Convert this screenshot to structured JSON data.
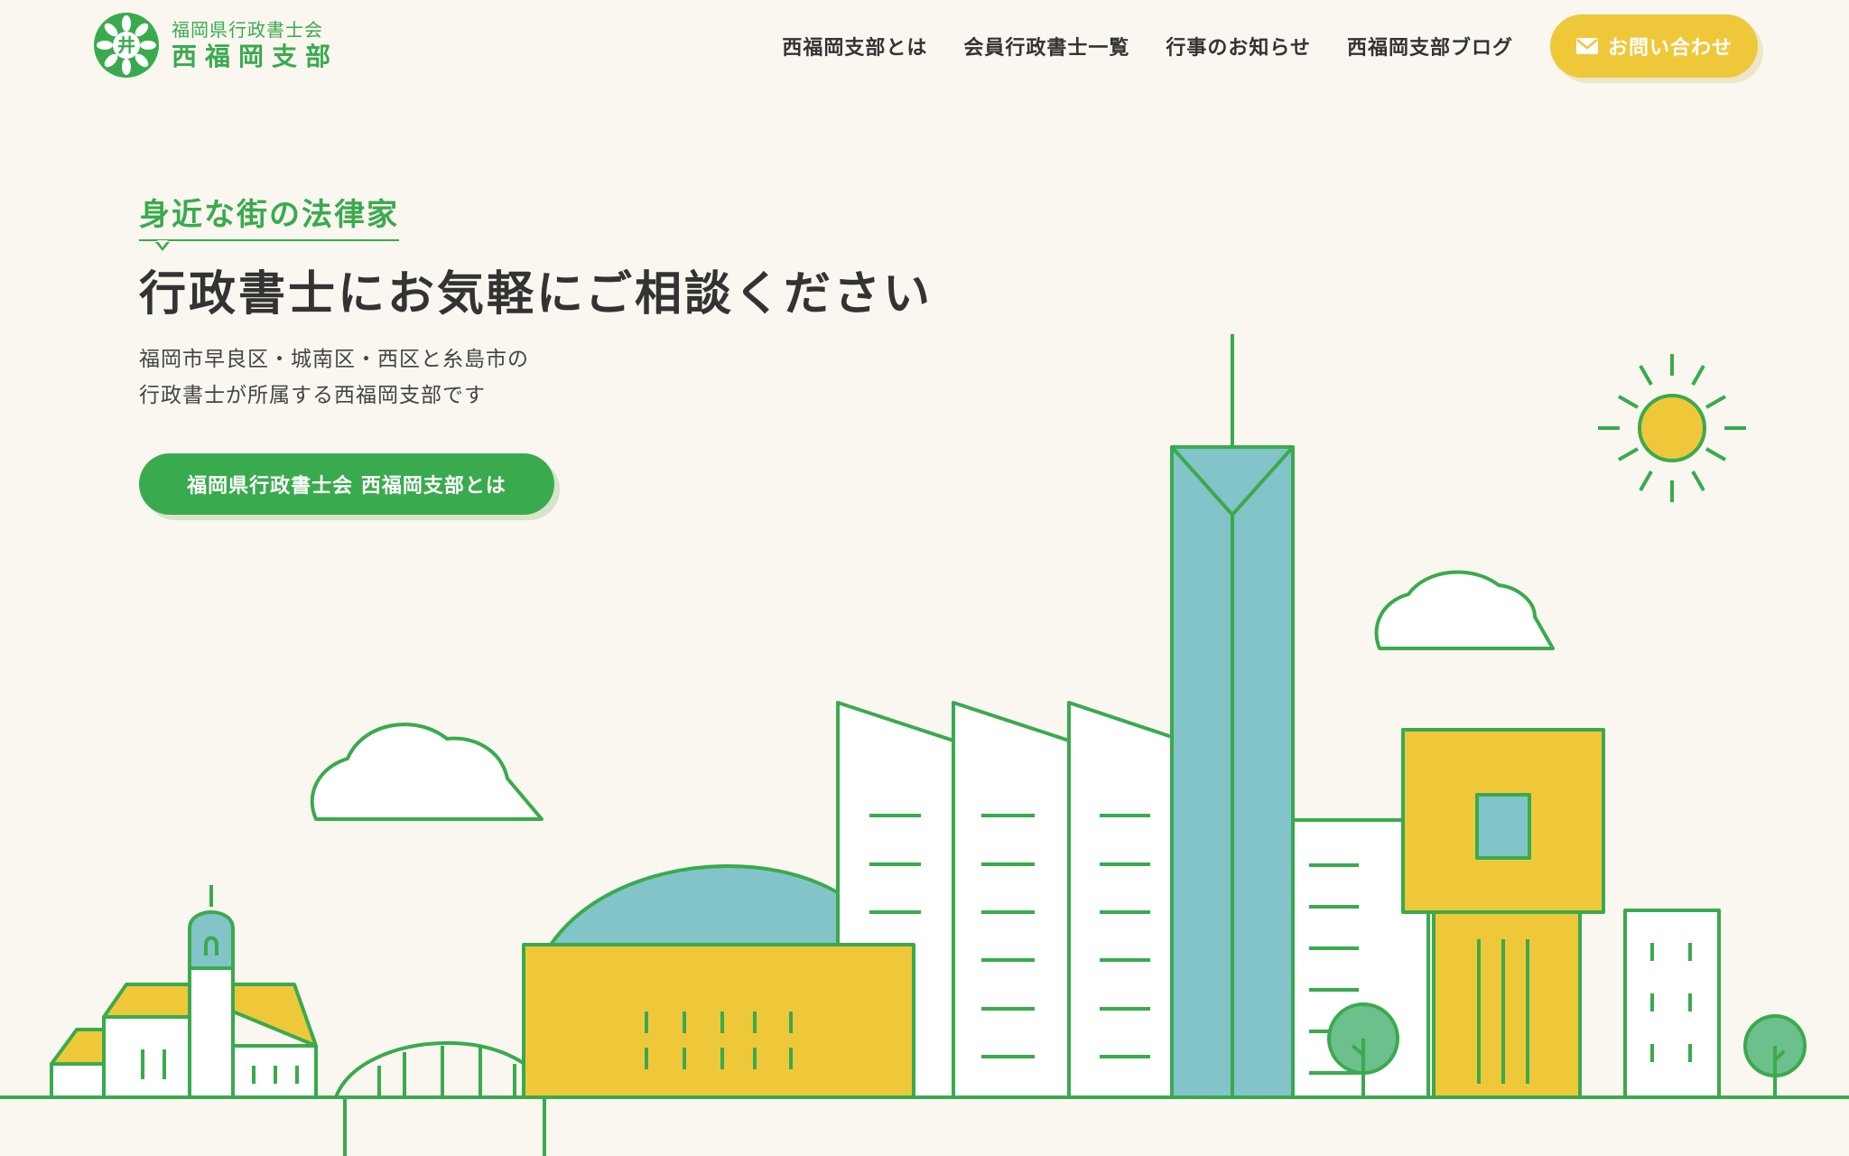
{
  "logo": {
    "line1": "福岡県行政書士会",
    "line2": "西福岡支部",
    "emblem_text": "井"
  },
  "nav": {
    "items": [
      {
        "label": "西福岡支部とは"
      },
      {
        "label": "会員行政書士一覧"
      },
      {
        "label": "行事のお知らせ"
      },
      {
        "label": "西福岡支部ブログ"
      }
    ],
    "contact_label": "お問い合わせ",
    "contact_icon": "envelope-icon"
  },
  "hero": {
    "catch": "身近な街の法律家",
    "headline": "行政書士にお気軽にご相談ください",
    "desc_line1": "福岡市早良区・城南区・西区と糸島市の",
    "desc_line2": "行政書士が所属する西福岡支部です",
    "button_label": "福岡県行政書士会 西福岡支部とは"
  },
  "colors": {
    "green": "#3aaa4e",
    "yellow": "#efc83a",
    "teal": "#82c4c8",
    "background": "#f9f7ef",
    "tree": "#6cc08b"
  }
}
